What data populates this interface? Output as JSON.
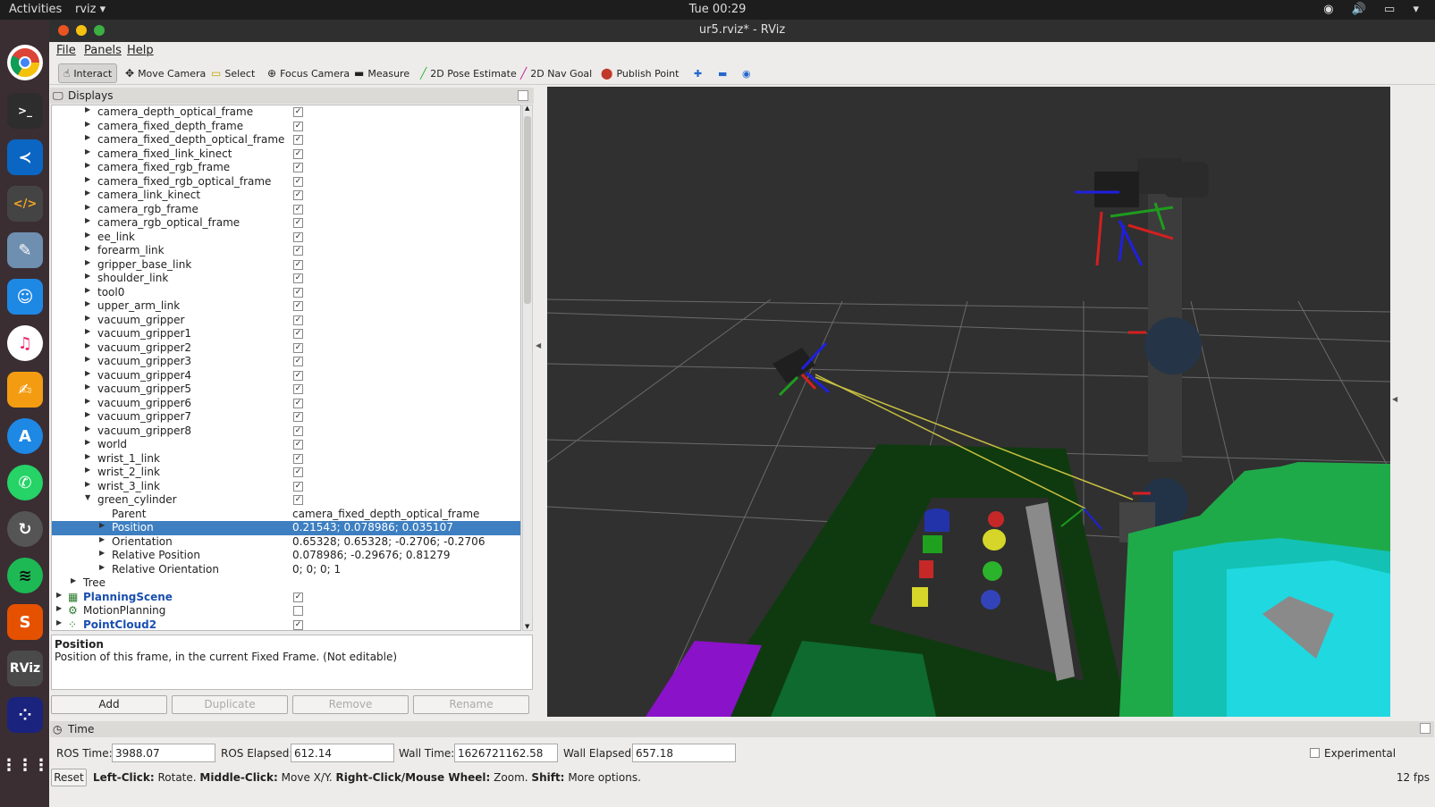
{
  "topbar": {
    "activities": "Activities",
    "app": "rviz",
    "clock": "Tue 00:29"
  },
  "window": {
    "title": "ur5.rviz* - RViz"
  },
  "menu": {
    "file": "File",
    "panels": "Panels",
    "help": "Help"
  },
  "toolbar": {
    "interact": "Interact",
    "move_camera": "Move Camera",
    "select": "Select",
    "focus_camera": "Focus Camera",
    "measure": "Measure",
    "pose_estimate": "2D Pose Estimate",
    "nav_goal": "2D Nav Goal",
    "publish_point": "Publish Point"
  },
  "displays": {
    "title": "Displays",
    "frames": [
      "camera_depth_optical_frame",
      "camera_fixed_depth_frame",
      "camera_fixed_depth_optical_frame",
      "camera_fixed_link_kinect",
      "camera_fixed_rgb_frame",
      "camera_fixed_rgb_optical_frame",
      "camera_link_kinect",
      "camera_rgb_frame",
      "camera_rgb_optical_frame",
      "ee_link",
      "forearm_link",
      "gripper_base_link",
      "shoulder_link",
      "tool0",
      "upper_arm_link",
      "vacuum_gripper",
      "vacuum_gripper1",
      "vacuum_gripper2",
      "vacuum_gripper3",
      "vacuum_gripper4",
      "vacuum_gripper5",
      "vacuum_gripper6",
      "vacuum_gripper7",
      "vacuum_gripper8",
      "world",
      "wrist_1_link",
      "wrist_2_link",
      "wrist_3_link",
      "green_cylinder"
    ],
    "props": [
      {
        "name": "Parent",
        "value": "camera_fixed_depth_optical_frame"
      },
      {
        "name": "Position",
        "value": "0.21543; 0.078986; 0.035107"
      },
      {
        "name": "Orientation",
        "value": "0.65328; 0.65328; -0.2706; -0.2706"
      },
      {
        "name": "Relative Position",
        "value": "0.078986; -0.29676; 0.81279"
      },
      {
        "name": "Relative Orientation",
        "value": "0; 0; 0; 1"
      }
    ],
    "tree_label": "Tree",
    "top_displays": [
      {
        "name": "PlanningScene",
        "checked": true
      },
      {
        "name": "MotionPlanning",
        "checked": false
      },
      {
        "name": "PointCloud2",
        "checked": true
      }
    ]
  },
  "description": {
    "title": "Position",
    "text": "Position of this frame, in the current Fixed Frame. (Not editable)"
  },
  "buttons": {
    "add": "Add",
    "duplicate": "Duplicate",
    "remove": "Remove",
    "rename": "Rename"
  },
  "time": {
    "title": "Time",
    "ros_time_label": "ROS Time:",
    "ros_time": "3988.07",
    "ros_elapsed_label": "ROS Elapsed:",
    "ros_elapsed": "612.14",
    "wall_time_label": "Wall Time:",
    "wall_time": "1626721162.58",
    "wall_elapsed_label": "Wall Elapsed:",
    "wall_elapsed": "657.18",
    "experimental": "Experimental"
  },
  "hint": {
    "reset": "Reset",
    "left_click": "Left-Click:",
    "left_action": "Rotate.",
    "middle_click": "Middle-Click:",
    "middle_action": "Move X/Y.",
    "right_click": "Right-Click/Mouse Wheel:",
    "right_action": "Zoom.",
    "shift": "Shift:",
    "shift_action": "More options.",
    "fps": "12 fps"
  },
  "colors": {
    "selection": "#3d7fc1",
    "viewport_bg": "#303030",
    "dock": "#3a2e33"
  }
}
